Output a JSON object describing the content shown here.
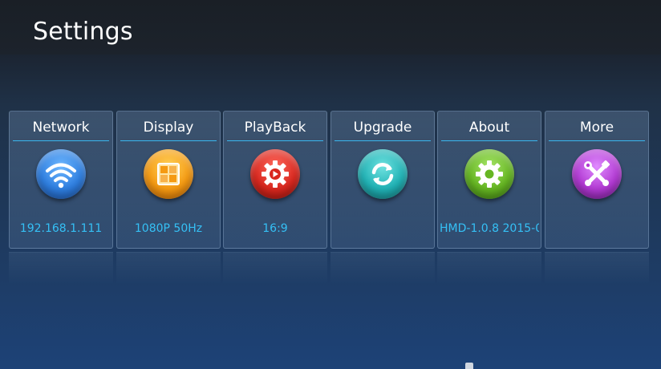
{
  "header": {
    "title": "Settings"
  },
  "tiles": [
    {
      "label": "Network",
      "value": "192.168.1.111",
      "icon": "wifi-icon",
      "color": "#2f7fe0"
    },
    {
      "label": "Display",
      "value": "1080P 50Hz",
      "icon": "display-icon",
      "color": "#f59a12"
    },
    {
      "label": "PlayBack",
      "value": "16:9",
      "icon": "playback-gear-icon",
      "color": "#d9281f"
    },
    {
      "label": "Upgrade",
      "value": "",
      "icon": "refresh-icon",
      "color": "#21b2b5"
    },
    {
      "label": "About",
      "value": "HMD-1.0.8 2015-0",
      "icon": "gear-icon",
      "color": "#66b623"
    },
    {
      "label": "More",
      "value": "",
      "icon": "tools-icon",
      "color": "#b23ad3"
    }
  ]
}
